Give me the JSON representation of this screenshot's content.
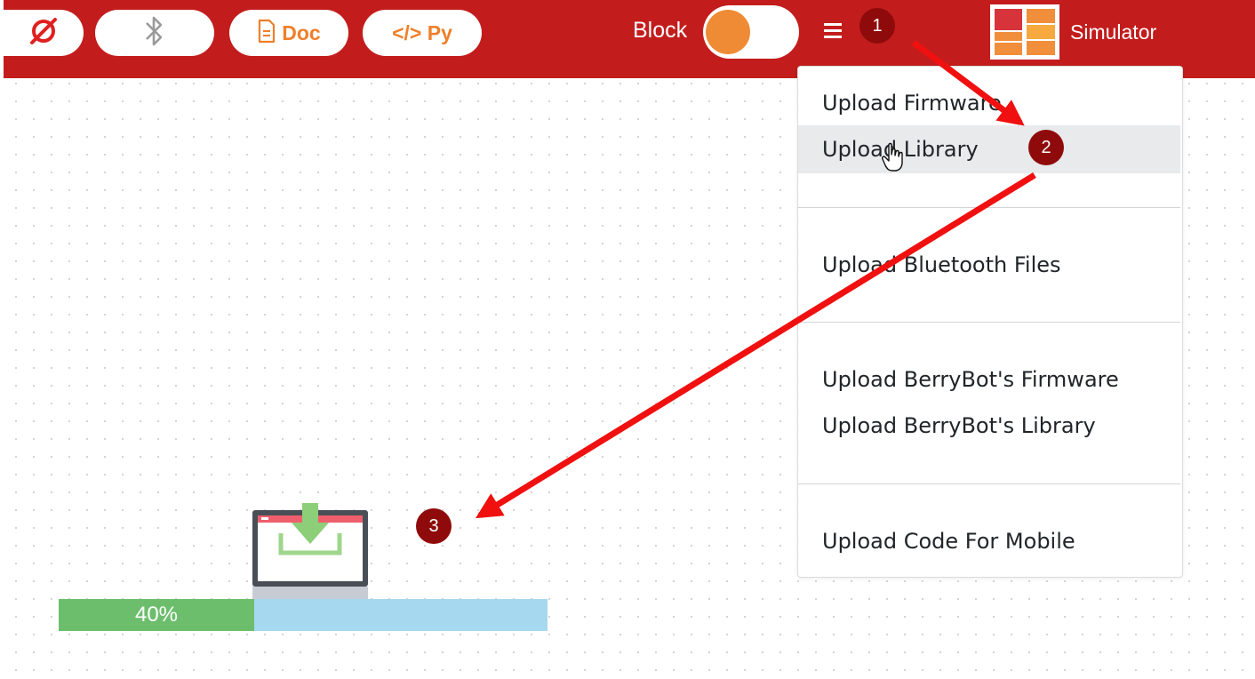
{
  "toolbar": {
    "doc_label": "Doc",
    "py_label": "</> Py",
    "block_label": "Block",
    "simulator_label": "Simulator"
  },
  "menu": {
    "items": [
      {
        "label": "Upload Firmware"
      },
      {
        "label": "Upload Library",
        "highlighted": true
      },
      {
        "label": "Upload Bluetooth Files"
      },
      {
        "label": "Upload BerryBot's Firmware"
      },
      {
        "label": "Upload BerryBot's Library"
      },
      {
        "label": "Upload Code For Mobile"
      }
    ]
  },
  "progress": {
    "label": "40%",
    "fraction": 0.4
  },
  "annotations": {
    "badges": [
      "1",
      "2",
      "3"
    ]
  },
  "colors": {
    "topbar": "#c31c1c",
    "accent_orange": "#ef7f2a",
    "progress_done": "#6cbe6c",
    "progress_track": "#a6d8ef",
    "annotation_arrow": "#f01010",
    "annotation_badge": "#8f0b0b"
  },
  "icons": [
    "disconnected-icon",
    "bluetooth-icon",
    "document-icon",
    "hamburger-menu-icon",
    "simulator-logo-icon",
    "download-monitor-icon",
    "hand-cursor-icon"
  ]
}
